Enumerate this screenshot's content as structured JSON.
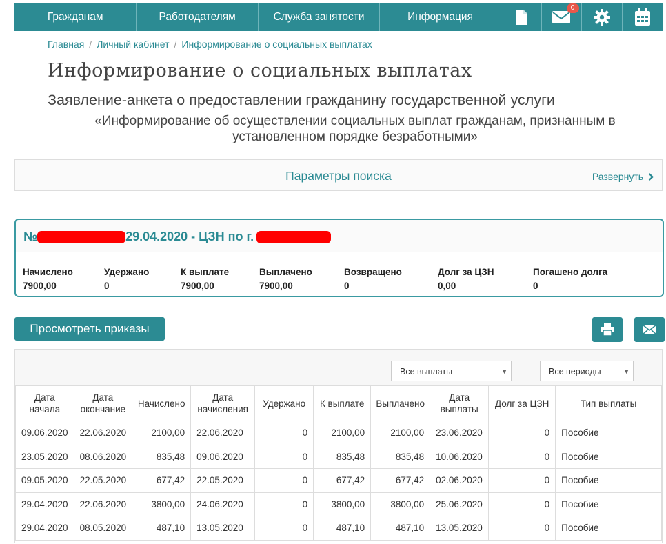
{
  "nav": {
    "items": [
      "Гражданам",
      "Работодателям",
      "Служба занятости",
      "Информация"
    ],
    "messages_badge": "0",
    "icons": [
      "document-icon",
      "mail-icon",
      "gear-icon",
      "calendar-icon"
    ]
  },
  "breadcrumb": [
    "Главная",
    "Личный кабинет",
    "Информирование о социальных выплатах"
  ],
  "page_title": "Информирование о социальных выплатах",
  "subtitle": "Заявление-анкета о предоставлении гражданину государственной услуги",
  "subtitle2": "«Информирование об осуществлении социальных выплат гражданам, признанным в установленном порядке безработными»",
  "search": {
    "title": "Параметры поиска",
    "expand": "Развернуть"
  },
  "card": {
    "title_prefix": "№",
    "title_middle": "29.04.2020 - ЦЗН по г.",
    "stats": [
      {
        "label": "Начислено",
        "value": "7900,00"
      },
      {
        "label": "Удержано",
        "value": "0"
      },
      {
        "label": "К выплате",
        "value": "7900,00"
      },
      {
        "label": "Выплачено",
        "value": "7900,00"
      },
      {
        "label": "Возвращено",
        "value": "0"
      },
      {
        "label": "Долг за ЦЗН",
        "value": "0,00"
      },
      {
        "label": "Погашено долга",
        "value": "0"
      }
    ]
  },
  "buttons": {
    "orders": "Просмотреть приказы"
  },
  "filters": {
    "payments": "Все выплаты",
    "periods": "Все периоды"
  },
  "table": {
    "headers": [
      "Дата начала",
      "Дата окончание",
      "Начислено",
      "Дата начисления",
      "Удержано",
      "К выплате",
      "Выплачено",
      "Дата выплаты",
      "Долг за ЦЗН",
      "Тип выплаты"
    ],
    "rows": [
      [
        "09.06.2020",
        "22.06.2020",
        "2100,00",
        "22.06.2020",
        "0",
        "2100,00",
        "2100,00",
        "23.06.2020",
        "0",
        "Пособие"
      ],
      [
        "23.05.2020",
        "08.06.2020",
        "835,48",
        "09.06.2020",
        "0",
        "835,48",
        "835,48",
        "10.06.2020",
        "0",
        "Пособие"
      ],
      [
        "09.05.2020",
        "22.05.2020",
        "677,42",
        "22.05.2020",
        "0",
        "677,42",
        "677,42",
        "02.06.2020",
        "0",
        "Пособие"
      ],
      [
        "29.04.2020",
        "22.06.2020",
        "3800,00",
        "24.06.2020",
        "0",
        "3800,00",
        "3800,00",
        "25.06.2020",
        "0",
        "Пособие"
      ],
      [
        "29.04.2020",
        "08.05.2020",
        "487,10",
        "13.05.2020",
        "0",
        "487,10",
        "487,10",
        "13.05.2020",
        "0",
        "Пособие"
      ]
    ]
  },
  "colors": {
    "accent": "#2c8b93",
    "badge": "#e8574a",
    "redaction": "#ff0000"
  }
}
